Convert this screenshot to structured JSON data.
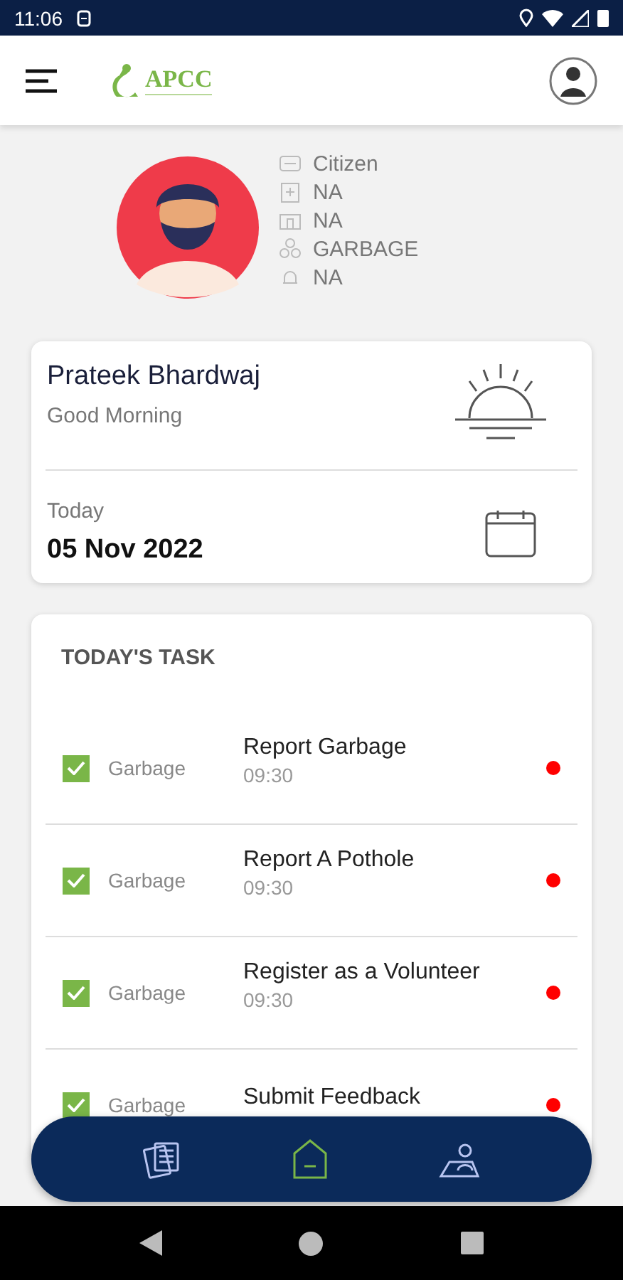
{
  "status_bar": {
    "time": "11:06"
  },
  "app_bar": {
    "logo_text": "APCC"
  },
  "profile": {
    "details": [
      {
        "kind": "role",
        "text": "Citizen"
      },
      {
        "kind": "hospital",
        "text": "NA"
      },
      {
        "kind": "building",
        "text": "NA"
      },
      {
        "kind": "group",
        "text": "GARBAGE"
      },
      {
        "kind": "bell",
        "text": "NA"
      }
    ]
  },
  "greeting_card": {
    "name": "Prateek Bhardwaj",
    "greeting": "Good Morning",
    "date_label": "Today",
    "date": "05 Nov 2022"
  },
  "tasks": {
    "title": "TODAY'S TASK",
    "items": [
      {
        "category": "Garbage",
        "title": "Report Garbage",
        "time": "09:30",
        "checked": true,
        "color": "#ff0000"
      },
      {
        "category": "Garbage",
        "title": "Report A Pothole",
        "time": "09:30",
        "checked": true,
        "color": "#ff0000"
      },
      {
        "category": "Garbage",
        "title": "Register as a Volunteer",
        "time": "09:30",
        "checked": true,
        "color": "#ff0000"
      },
      {
        "category": "Garbage",
        "title": "Submit Feedback",
        "checked": true,
        "color": "#ff0000"
      }
    ]
  },
  "bottom_nav": [
    {
      "kind": "documents",
      "selected": false
    },
    {
      "kind": "home",
      "selected": true
    },
    {
      "kind": "map",
      "selected": false
    }
  ]
}
